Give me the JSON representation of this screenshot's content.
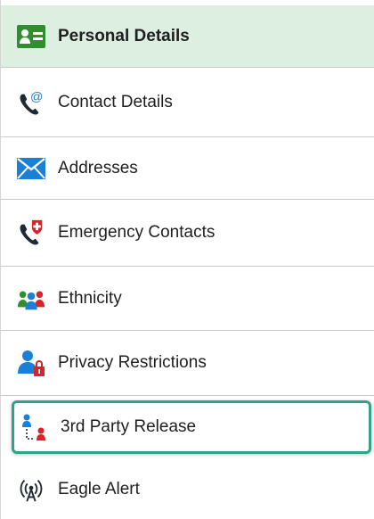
{
  "nav": {
    "items": [
      {
        "label": "Personal Details",
        "icon": "id-card-icon",
        "active": true
      },
      {
        "label": "Contact Details",
        "icon": "phone-email-icon"
      },
      {
        "label": "Addresses",
        "icon": "envelope-icon"
      },
      {
        "label": "Emergency Contacts",
        "icon": "phone-medical-icon"
      },
      {
        "label": "Ethnicity",
        "icon": "people-group-icon"
      },
      {
        "label": "Privacy Restrictions",
        "icon": "person-lock-icon"
      },
      {
        "label": "3rd Party Release",
        "icon": "people-release-icon",
        "highlighted": true
      },
      {
        "label": "Eagle Alert",
        "icon": "broadcast-alert-icon"
      }
    ]
  },
  "colors": {
    "active_bg": "#dcefe1",
    "highlight_border": "#2aa58b",
    "icon_green": "#2f8f2f",
    "icon_blue": "#1b7fd6",
    "icon_red": "#d6242a",
    "icon_dark": "#1f2a36"
  }
}
